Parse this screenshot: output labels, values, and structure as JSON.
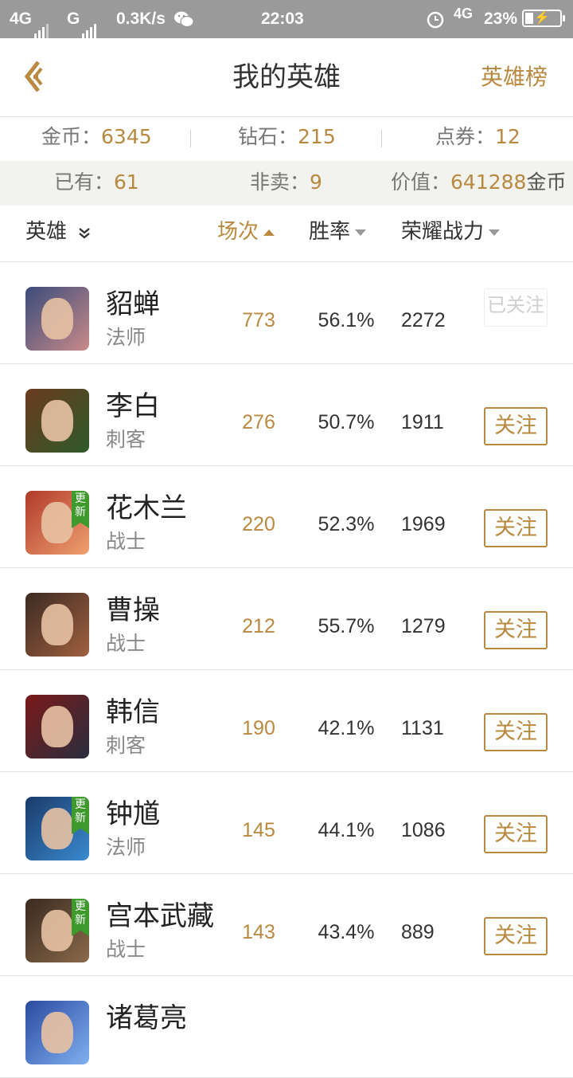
{
  "status_bar": {
    "net1": "4G",
    "net2": "G",
    "speed": "0.3K/s",
    "time": "22:03",
    "net3": "4G",
    "battery": "23%",
    "battery_level": 0.23
  },
  "header": {
    "title": "我的英雄",
    "right_link": "英雄榜"
  },
  "currency": [
    {
      "label": "金币：",
      "value": "6345"
    },
    {
      "label": "钻石：",
      "value": "215"
    },
    {
      "label": "点券：",
      "value": "12"
    }
  ],
  "stats": {
    "owned_label": "已有：",
    "owned_value": "61",
    "notsale_label": "非卖：",
    "notsale_value": "9",
    "worth_label": "价值：",
    "worth_value": "641288",
    "worth_unit": "金币"
  },
  "columns": {
    "hero": "英雄",
    "games": "场次",
    "winrate": "胜率",
    "power": "荣耀战力"
  },
  "heroes": [
    {
      "name": "貂蝉",
      "role": "法师",
      "games": "773",
      "winrate": "56.1%",
      "power": "2272",
      "follow": "已关注",
      "followed": true,
      "badge": "",
      "c1": "#3a4b7a",
      "c2": "#c98a8a"
    },
    {
      "name": "李白",
      "role": "刺客",
      "games": "276",
      "winrate": "50.7%",
      "power": "1911",
      "follow": "关注",
      "followed": false,
      "badge": "",
      "c1": "#6b3a1e",
      "c2": "#2f5a2a"
    },
    {
      "name": "花木兰",
      "role": "战士",
      "games": "220",
      "winrate": "52.3%",
      "power": "1969",
      "follow": "关注",
      "followed": false,
      "badge": "更新",
      "c1": "#b03a2a",
      "c2": "#f0a070"
    },
    {
      "name": "曹操",
      "role": "战士",
      "games": "212",
      "winrate": "55.7%",
      "power": "1279",
      "follow": "关注",
      "followed": false,
      "badge": "",
      "c1": "#3b2a22",
      "c2": "#a06040"
    },
    {
      "name": "韩信",
      "role": "刺客",
      "games": "190",
      "winrate": "42.1%",
      "power": "1131",
      "follow": "关注",
      "followed": false,
      "badge": "",
      "c1": "#7a1a1a",
      "c2": "#2a2e3e"
    },
    {
      "name": "钟馗",
      "role": "法师",
      "games": "145",
      "winrate": "44.1%",
      "power": "1086",
      "follow": "关注",
      "followed": false,
      "badge": "更新",
      "c1": "#1a3a6a",
      "c2": "#3a8ad0"
    },
    {
      "name": "宫本武藏",
      "role": "战士",
      "games": "143",
      "winrate": "43.4%",
      "power": "889",
      "follow": "关注",
      "followed": false,
      "badge": "更新",
      "c1": "#3a2a20",
      "c2": "#8a6a4a"
    },
    {
      "name": "诸葛亮",
      "role": "",
      "games": "",
      "winrate": "",
      "power": "",
      "follow": "",
      "followed": false,
      "badge": "",
      "c1": "#2a4aa0",
      "c2": "#80b0f0"
    }
  ],
  "colors": {
    "accent": "#b8893f",
    "update_badge": "#3e9a2c"
  }
}
